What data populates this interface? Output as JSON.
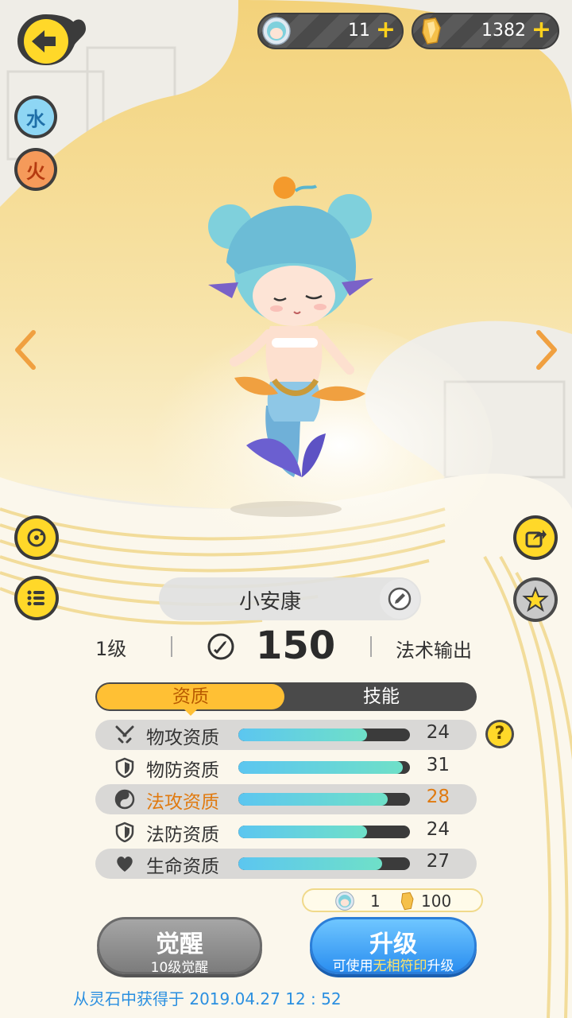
{
  "topbar": {
    "currency_tickets": {
      "value": "11",
      "icon": "mermaid-face-icon"
    },
    "currency_crystals": {
      "value": "1382",
      "icon": "crystal-icon"
    },
    "plus": "+"
  },
  "elements": [
    "水",
    "火"
  ],
  "pet": {
    "name": "小安康",
    "level": "1级",
    "power": "150",
    "role": "法术输出"
  },
  "tabs": {
    "aptitude": "资质",
    "skills": "技能",
    "active": "资质"
  },
  "stats": [
    {
      "label": "物攻资质",
      "value": "24",
      "fill": 0.75,
      "icon": "swords-icon",
      "shaded": true,
      "highlight": false
    },
    {
      "label": "物防资质",
      "value": "31",
      "fill": 0.96,
      "icon": "shield-icon",
      "shaded": false,
      "highlight": false
    },
    {
      "label": "法攻资质",
      "value": "28",
      "fill": 0.87,
      "icon": "yin-yang-icon",
      "shaded": true,
      "highlight": true
    },
    {
      "label": "法防资质",
      "value": "24",
      "fill": 0.75,
      "icon": "shield-icon",
      "shaded": false,
      "highlight": false
    },
    {
      "label": "生命资质",
      "value": "27",
      "fill": 0.84,
      "icon": "heart-icon",
      "shaded": true,
      "highlight": false
    }
  ],
  "help": "?",
  "cost": {
    "tickets": "1",
    "crystals": "100"
  },
  "buttons": {
    "awaken_label": "觉醒",
    "awaken_sub": "10级觉醒",
    "upgrade_label": "升级",
    "upgrade_sub_pre": "可使用",
    "upgrade_sub_hl": "无相符印",
    "upgrade_sub_post": "升级"
  },
  "obtained": "从灵石中获得于 2019.04.27   12 : 52",
  "colors": {
    "accent": "#ffd829",
    "blue": "#2a8ef0",
    "highlight": "#e07a10"
  }
}
